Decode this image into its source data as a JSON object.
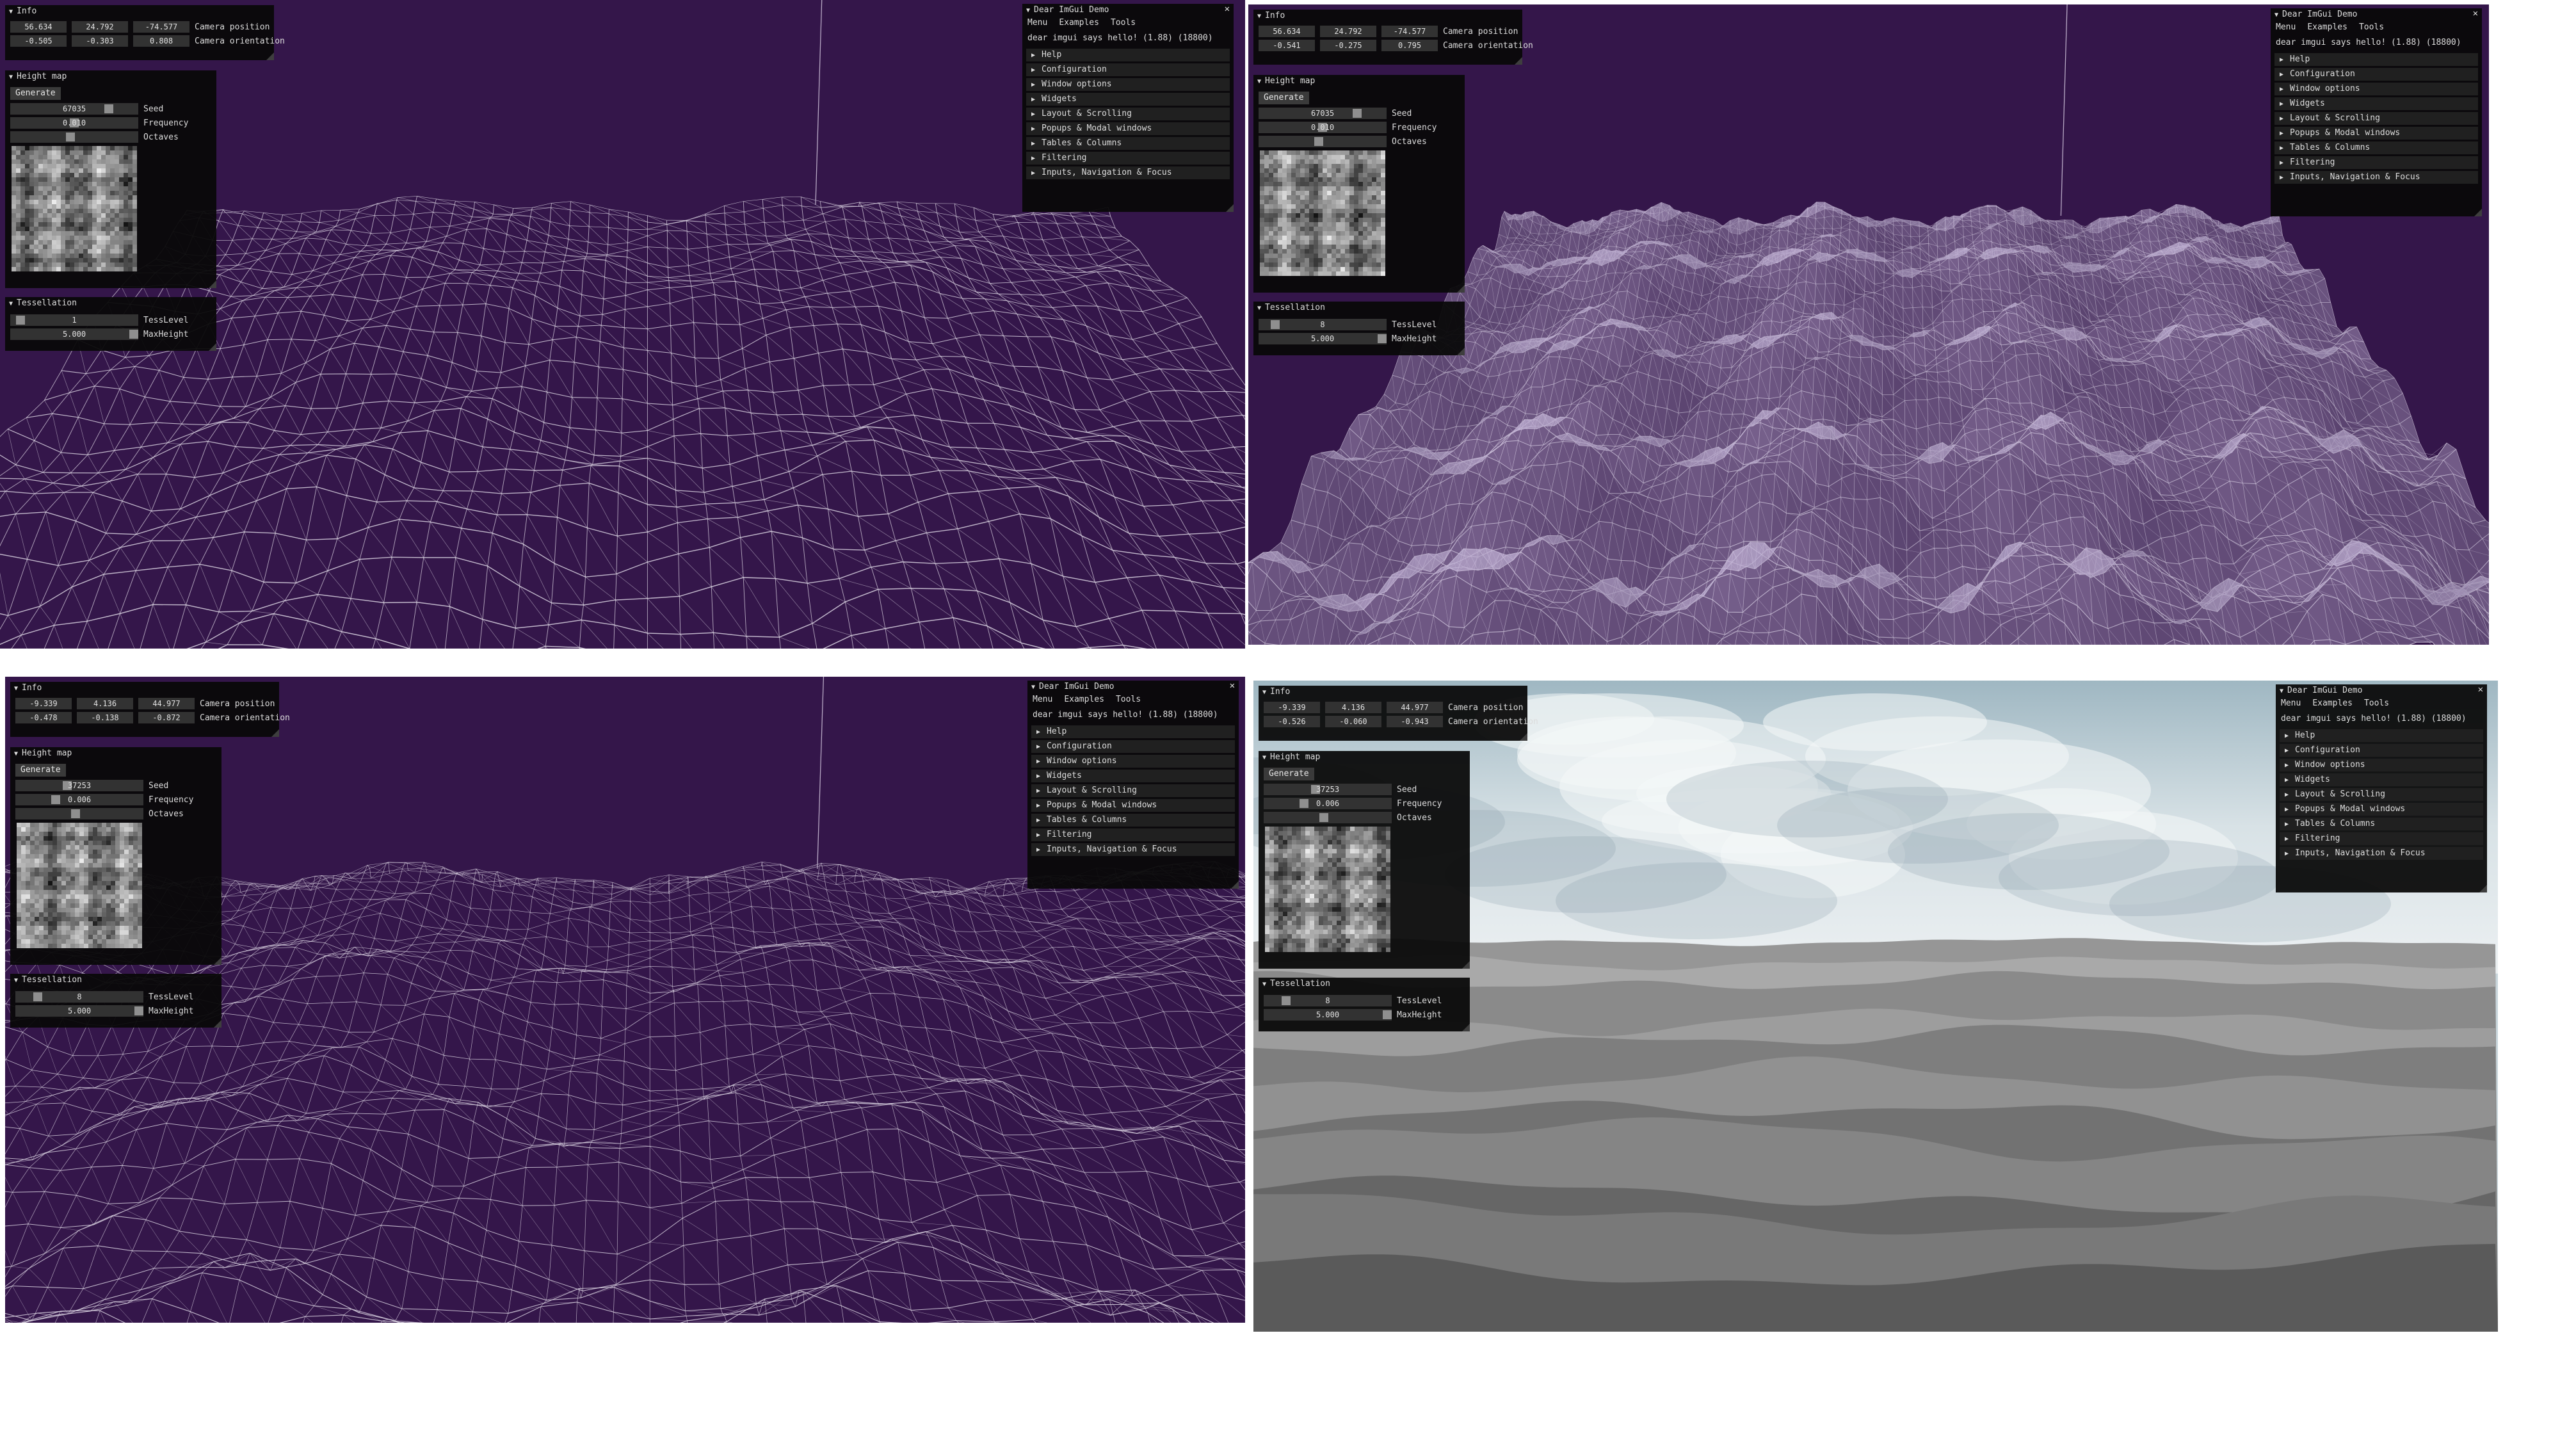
{
  "imgui": {
    "info_title": "Info",
    "camera_position_label": "Camera position",
    "camera_orientation_label": "Camera orientation",
    "heightmap_title": "Height map",
    "generate_label": "Generate",
    "seed_label": "Seed",
    "frequency_label": "Frequency",
    "octaves_label": "Octaves",
    "tessellation_title": "Tessellation",
    "tess_level_label": "TessLevel",
    "max_height_label": "MaxHeight",
    "demo_title": "Dear ImGui Demo",
    "demo_menu": [
      "Menu",
      "Examples",
      "Tools"
    ],
    "demo_hello": "dear imgui says hello! (1.88) (18800)",
    "demo_sections": [
      "Help",
      "Configuration",
      "Window options",
      "Widgets",
      "Layout & Scrolling",
      "Popups & Modal windows",
      "Tables & Columns",
      "Filtering",
      "Inputs, Navigation & Focus"
    ]
  },
  "panels": [
    {
      "render": "wireframe-coarse",
      "camera_position": [
        "56.634",
        "24.792",
        "-74.577"
      ],
      "camera_orientation": [
        "-0.505",
        "-0.303",
        "0.808"
      ],
      "seed": "67035",
      "frequency": "0.010",
      "tess_level": "1",
      "max_height": "5.000",
      "sliders": {
        "seed": 0.79,
        "frequency": 0.5,
        "octaves": 0.47,
        "tess_level": 0.05,
        "max_height": 1.0
      }
    },
    {
      "render": "wireframe-dense",
      "camera_position": [
        "56.634",
        "24.792",
        "-74.577"
      ],
      "camera_orientation": [
        "-0.541",
        "-0.275",
        "0.795"
      ],
      "seed": "67035",
      "frequency": "0.010",
      "tess_level": "8",
      "max_height": "5.000",
      "sliders": {
        "seed": 0.79,
        "frequency": 0.5,
        "octaves": 0.47,
        "tess_level": 0.1,
        "max_height": 1.0
      }
    },
    {
      "render": "wireframe-lowangle",
      "camera_position": [
        "-9.339",
        "4.136",
        "44.977"
      ],
      "camera_orientation": [
        "-0.478",
        "-0.138",
        "-0.872"
      ],
      "seed": "37253",
      "frequency": "0.006",
      "tess_level": "8",
      "max_height": "5.000",
      "sliders": {
        "seed": 0.4,
        "frequency": 0.3,
        "octaves": 0.47,
        "tess_level": 0.15,
        "max_height": 1.0
      }
    },
    {
      "render": "shaded-skybox",
      "camera_position": [
        "-9.339",
        "4.136",
        "44.977"
      ],
      "camera_orientation": [
        "-0.526",
        "-0.060",
        "-0.943"
      ],
      "seed": "37253",
      "frequency": "0.006",
      "tess_level": "8",
      "max_height": "5.000",
      "sliders": {
        "seed": 0.4,
        "frequency": 0.3,
        "octaves": 0.47,
        "tess_level": 0.15,
        "max_height": 1.0
      }
    }
  ],
  "colors": {
    "background_purple": "#34164a",
    "wireframe": "#d6d0dc",
    "window_bg": "#080808",
    "frame_bg": "#323232"
  }
}
